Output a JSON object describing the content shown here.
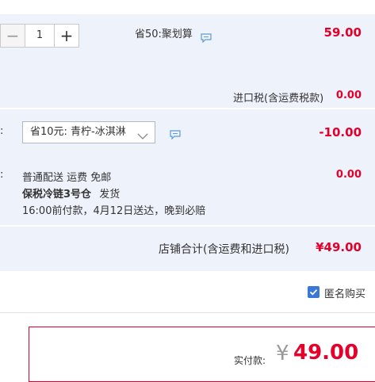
{
  "item": {
    "quantity": "1",
    "promo_label": "省50:聚划算",
    "price": "59.00",
    "import_tax_label": "进口税(含运费税款)",
    "import_tax_value": "0.00"
  },
  "coupon": {
    "colon": ":",
    "selected": "省10元: 青柠-冰淇淋",
    "discount": "-10.00"
  },
  "shipping": {
    "colon": ":",
    "line1": "普通配送 运费 免邮",
    "warehouse": "保税冷链3号仓",
    "ship_suffix": "发货",
    "line3": "16:00前付款，4月12日送达，晚到必赔",
    "fee": "0.00"
  },
  "subtotal": {
    "label": "店铺合计(含运费和进口税)",
    "value": "¥49.00"
  },
  "anonymous": {
    "label": "匿名购买"
  },
  "payment": {
    "label": "实付款:",
    "currency": "¥",
    "amount": "49.00"
  },
  "colors": {
    "accent_red": "#e4002b",
    "panel_blue": "#eef2fb",
    "checkbox_blue": "#3a78d8"
  },
  "icons": [
    "minus-icon",
    "plus-icon",
    "chat-icon",
    "chevron-down-icon",
    "checkmark-icon"
  ]
}
